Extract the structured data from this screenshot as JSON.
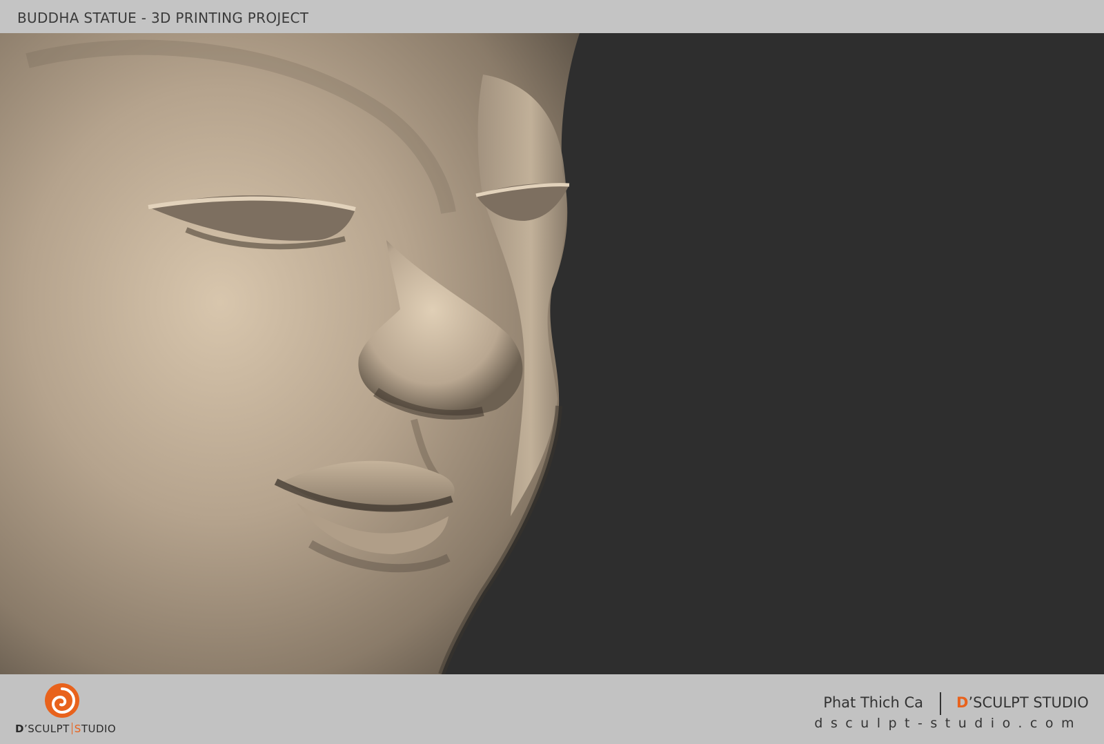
{
  "header": {
    "title": "BUDDHA STATUE - 3D PRINTING PROJECT"
  },
  "footer": {
    "logo": {
      "icon": "swirl-logo-icon",
      "text_bold": "D",
      "text_mark": "’",
      "text_rest": "SCULPT",
      "text_accent": "S",
      "text_tail": "TUDIO"
    },
    "caption": {
      "name": "Phat Thich Ca",
      "studio_accent": "D",
      "studio_rest": "’SCULPT STUDIO",
      "url": "dsculpt-studio.com"
    }
  },
  "colors": {
    "accent": "#e8621c",
    "background": "#2e2e2e",
    "bars": "#c2c2c2",
    "stone": "#b8a690"
  }
}
